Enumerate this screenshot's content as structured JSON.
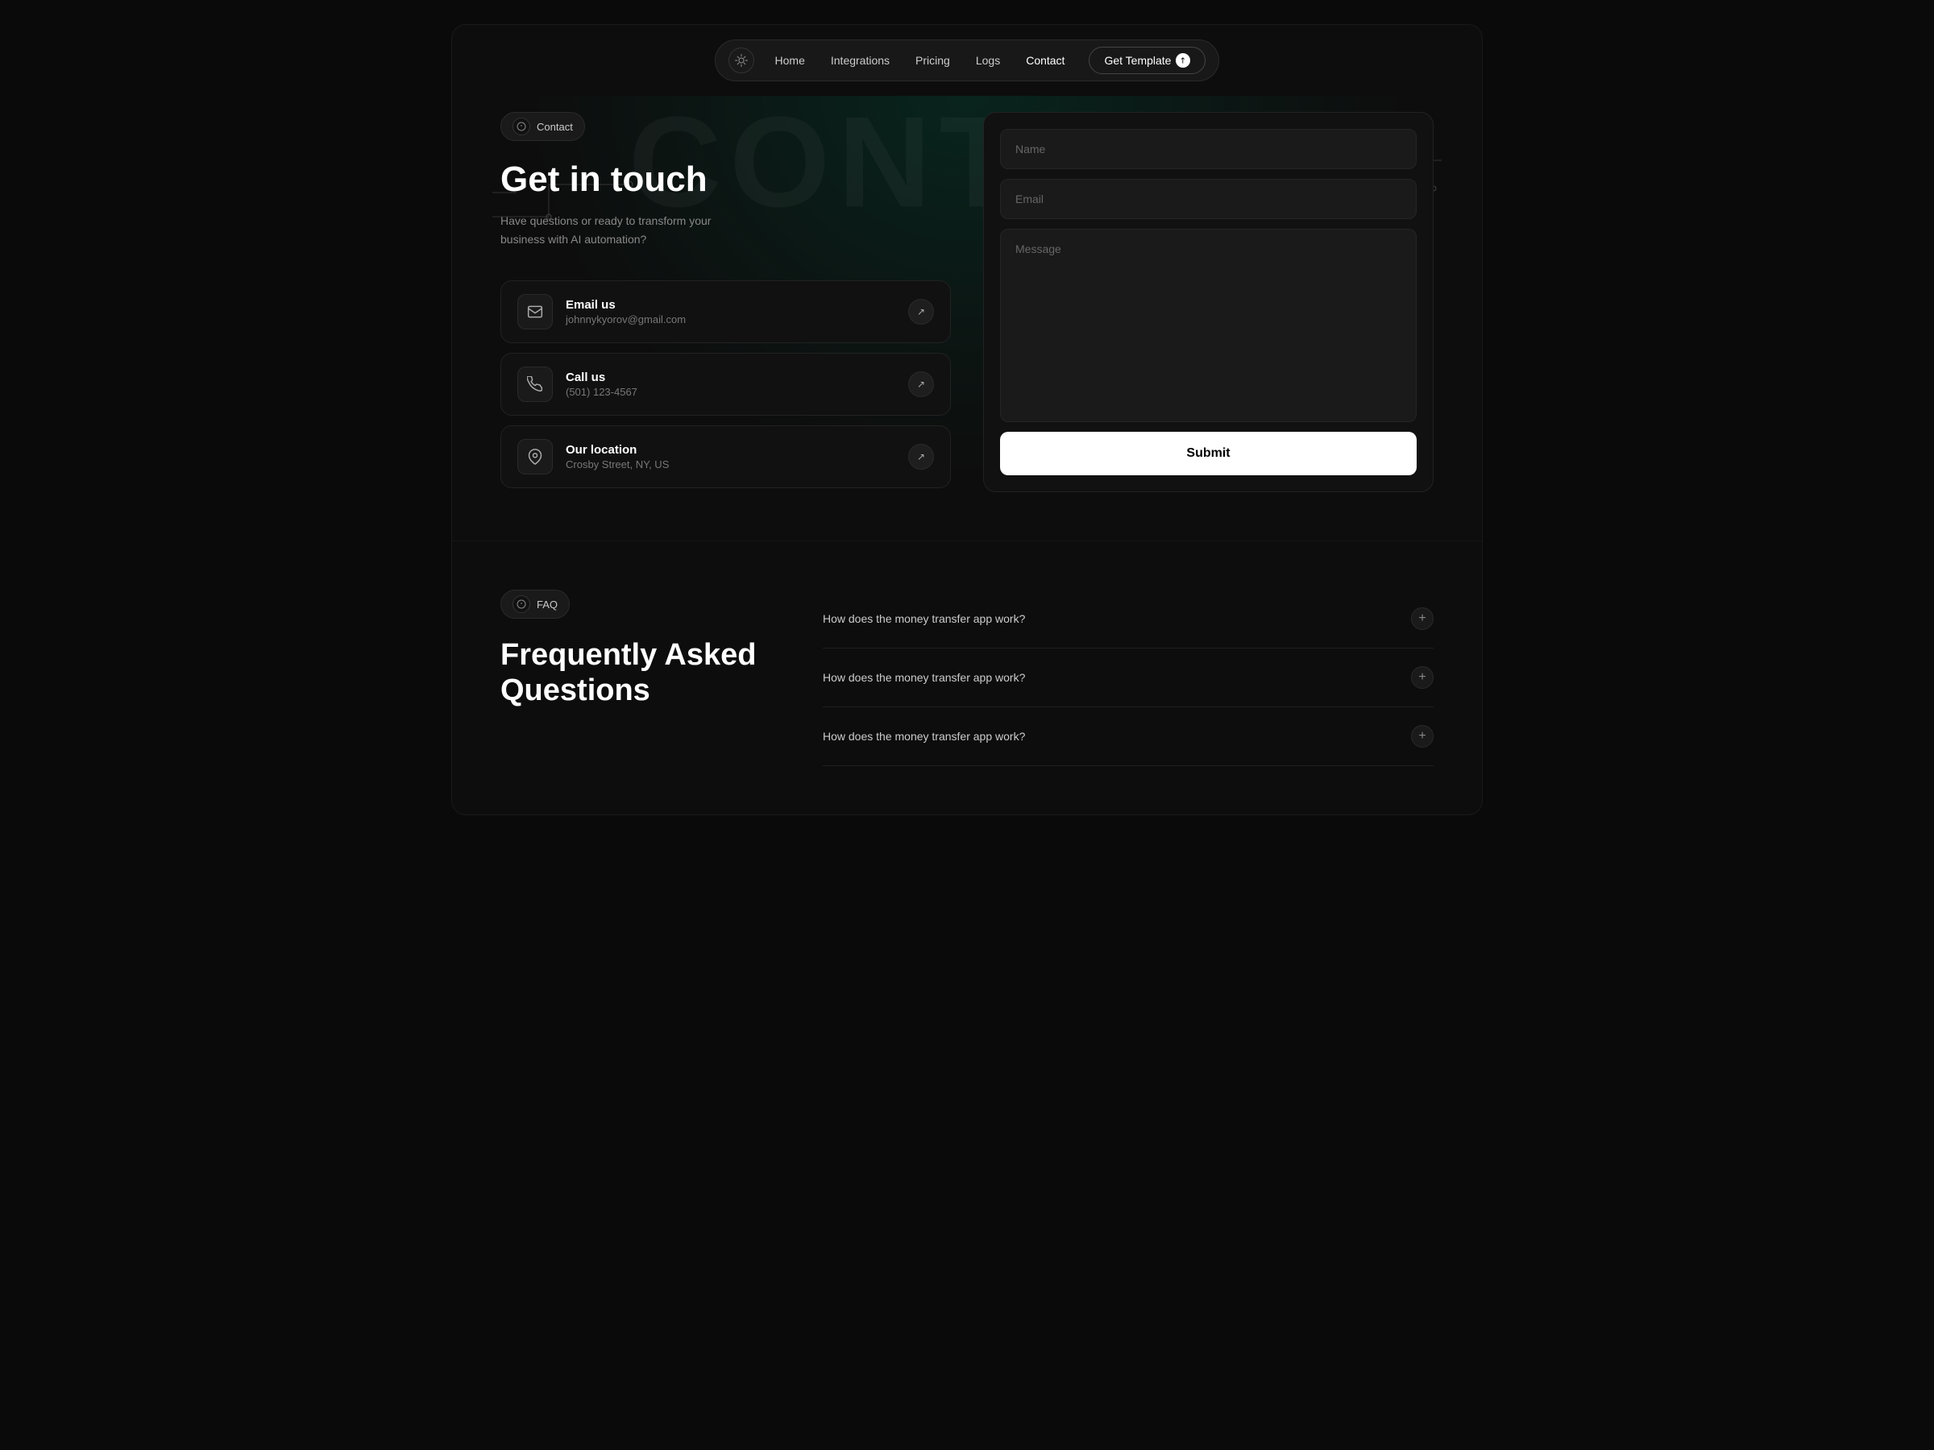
{
  "navbar": {
    "logo_alt": "logo",
    "links": [
      {
        "label": "Home",
        "active": false
      },
      {
        "label": "Integrations",
        "active": false
      },
      {
        "label": "Pricing",
        "active": false
      },
      {
        "label": "Logs",
        "active": false
      },
      {
        "label": "Contact",
        "active": true
      }
    ],
    "cta_label": "Get Template"
  },
  "hero": {
    "watermark": "CONTACT"
  },
  "contact_section": {
    "badge_label": "Contact",
    "title": "Get in touch",
    "description": "Have questions or ready to transform your business with AI automation?",
    "cards": [
      {
        "id": "email",
        "title": "Email us",
        "subtitle": "johnnykyorov@gmail.com",
        "icon": "email"
      },
      {
        "id": "phone",
        "title": "Call us",
        "subtitle": "(501) 123-4567",
        "icon": "phone"
      },
      {
        "id": "location",
        "title": "Our location",
        "subtitle": "Crosby Street, NY, US",
        "icon": "location"
      }
    ]
  },
  "form": {
    "name_placeholder": "Name",
    "email_placeholder": "Email",
    "message_placeholder": "Message",
    "submit_label": "Submit"
  },
  "faq_section": {
    "badge_label": "FAQ",
    "title": "Frequently Asked Questions",
    "items": [
      {
        "question": "How does the money transfer app work?"
      },
      {
        "question": "How does the money transfer app work?"
      },
      {
        "question": "How does the money transfer app work?"
      }
    ]
  }
}
